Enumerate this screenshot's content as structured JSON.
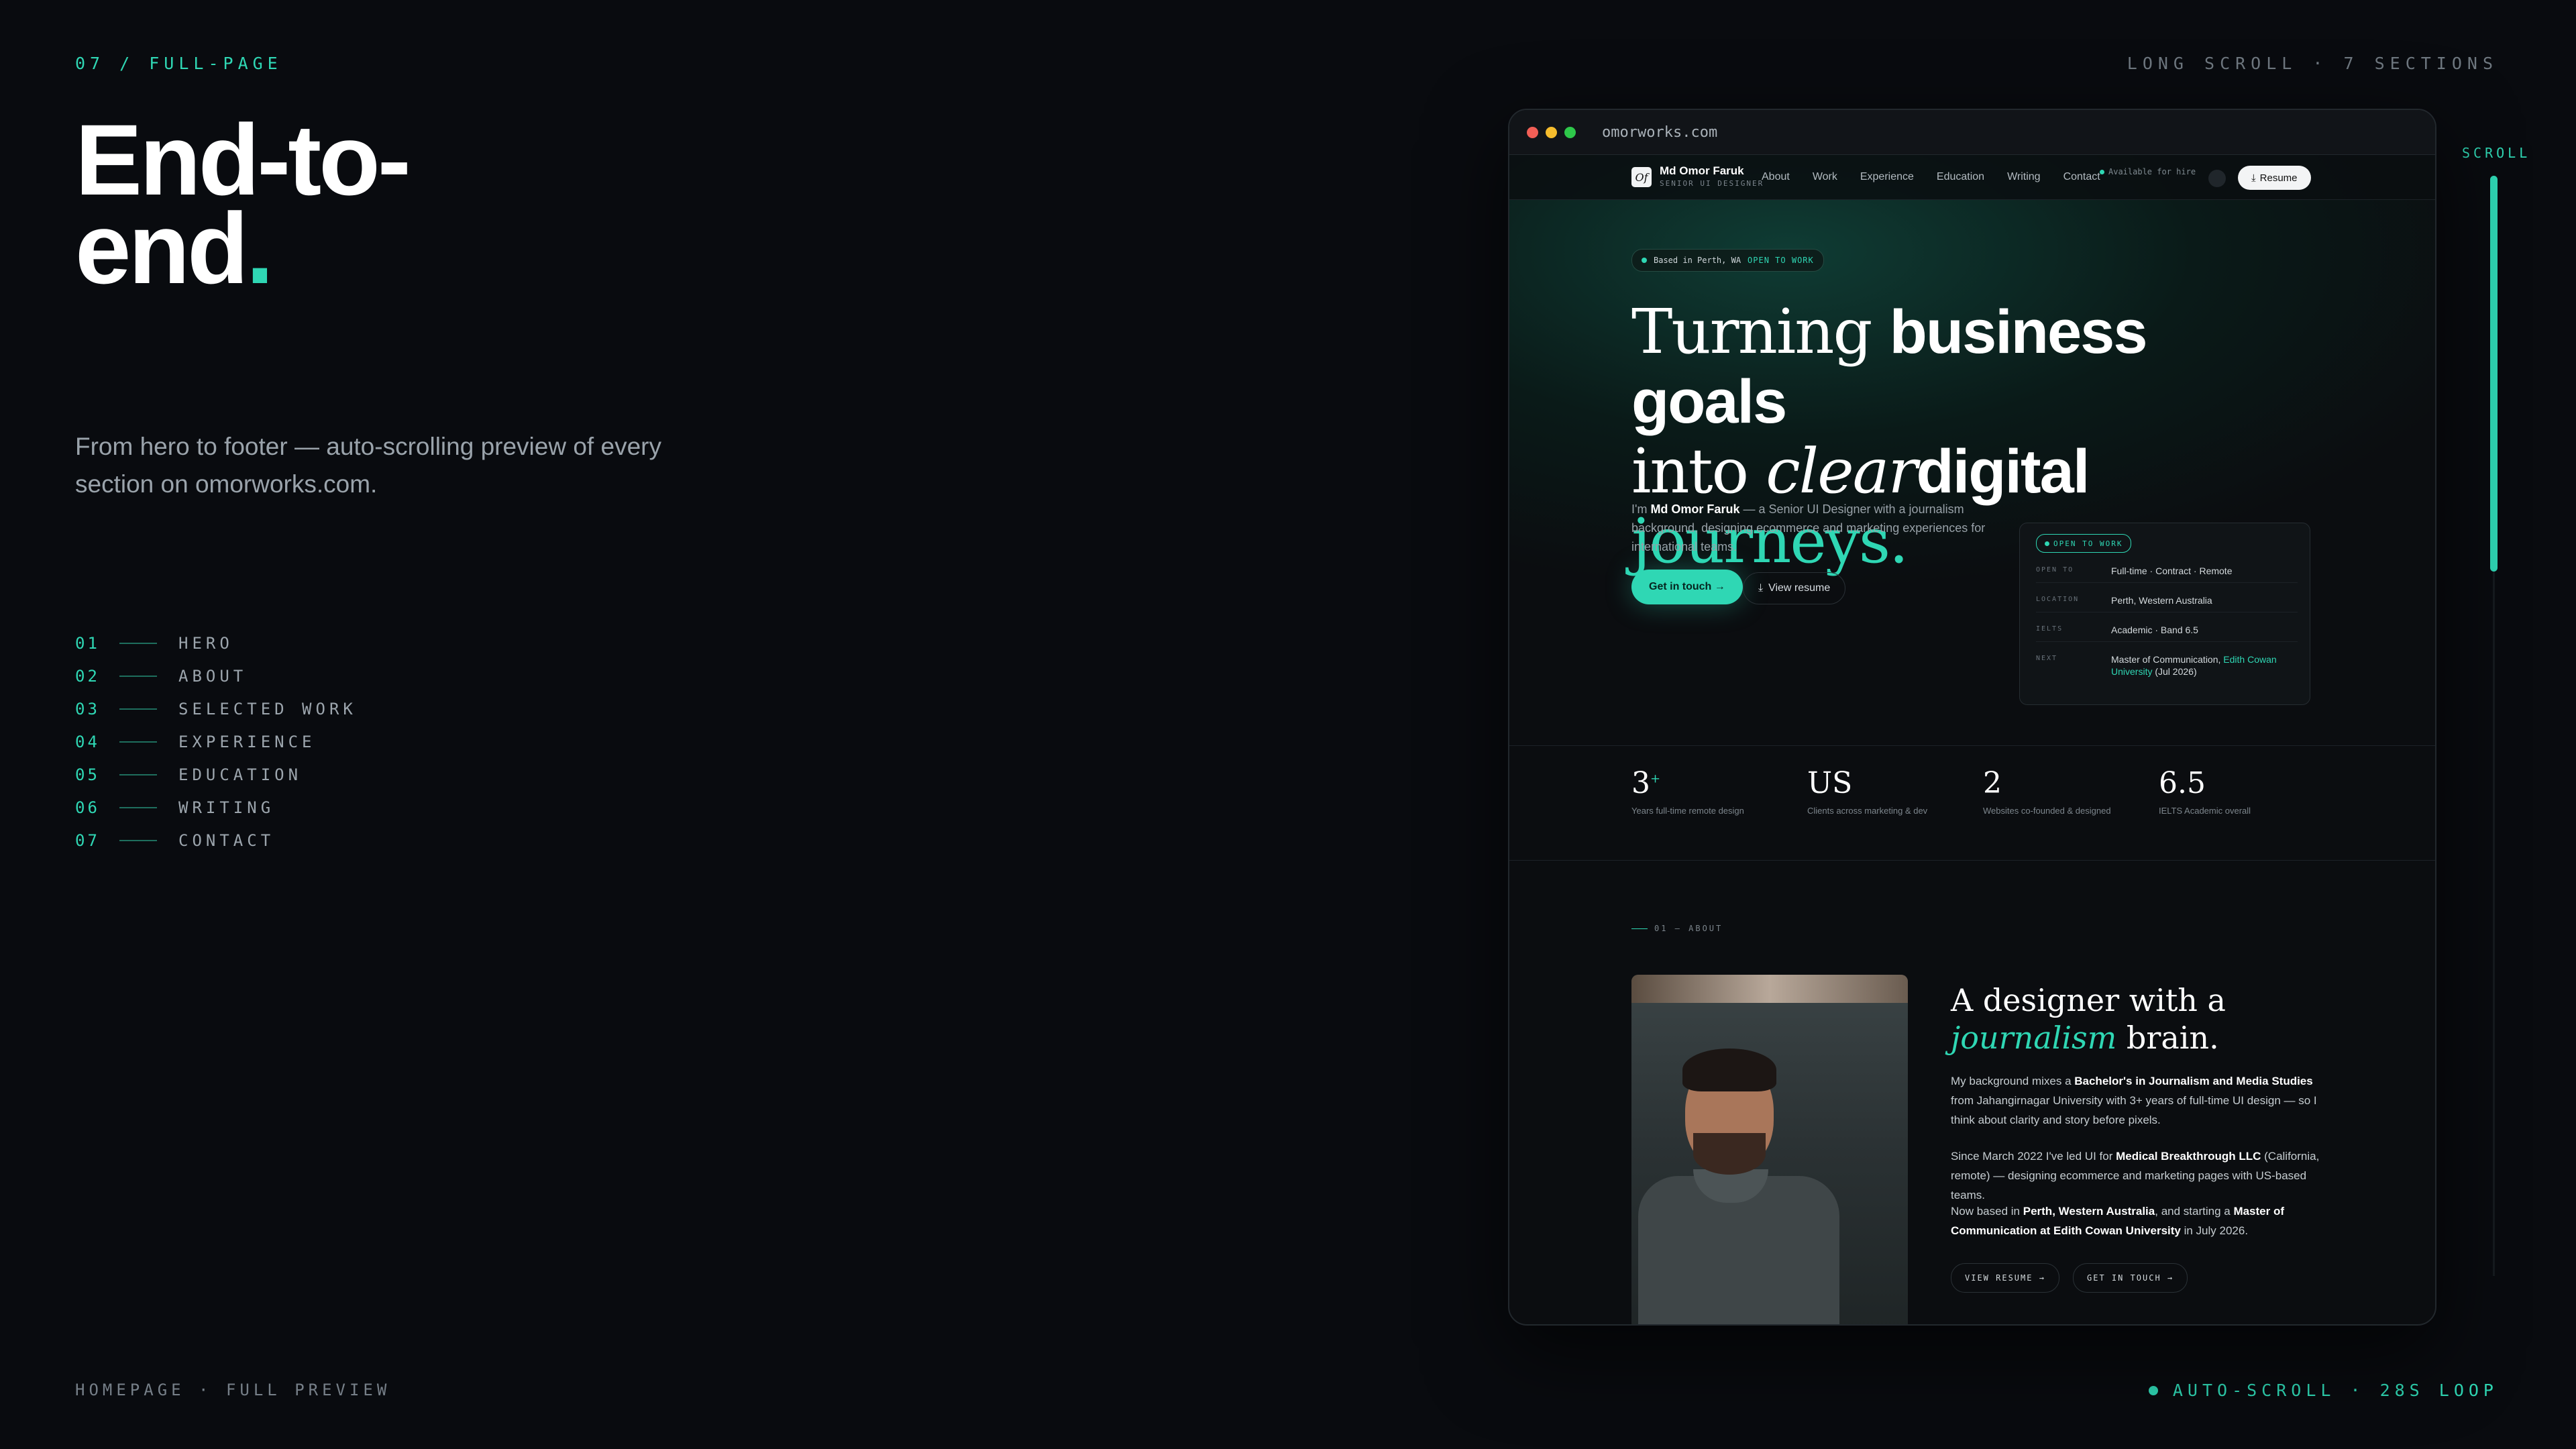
{
  "section_kicker": "07 / FULL-PAGE",
  "headline": {
    "line1": "End-to-",
    "line2": "end",
    "dot": "."
  },
  "lede": "From hero to footer — auto-scrolling preview of every section on omorworks.com.",
  "toc": [
    {
      "num": "01",
      "label": "HERO"
    },
    {
      "num": "02",
      "label": "ABOUT"
    },
    {
      "num": "03",
      "label": "SELECTED WORK"
    },
    {
      "num": "04",
      "label": "EXPERIENCE"
    },
    {
      "num": "05",
      "label": "EDUCATION"
    },
    {
      "num": "06",
      "label": "WRITING"
    },
    {
      "num": "07",
      "label": "CONTACT"
    }
  ],
  "meta_top_right": "LONG SCROLL · 7 SECTIONS",
  "scroll_label": "SCROLL",
  "scroll_progress_fraction": 0.36,
  "footer_left": "HOMEPAGE · FULL PREVIEW",
  "footer_right": "AUTO-SCROLL · 28S LOOP",
  "colors": {
    "accent": "#2fd7b4",
    "background": "#090b0f"
  },
  "browser": {
    "url": "omorworks.com",
    "site": {
      "logo": "Of",
      "brand_name": "Md Omor Faruk",
      "brand_role": "SENIOR UI DESIGNER",
      "nav": [
        "About",
        "Work",
        "Experience",
        "Education",
        "Writing",
        "Contact"
      ],
      "status": "Available for hire",
      "resume_button": "Resume",
      "location_pill": "Based in Perth, WA",
      "open_to_work": "OPEN TO WORK",
      "hero": {
        "w1": "Turning ",
        "w2": "business goals",
        "w3": "into ",
        "w4": "clear",
        "w5": "digital ",
        "w6": "journeys."
      },
      "intro_prefix": "I'm ",
      "intro_name": "Md Omor Faruk",
      "intro_rest": " — a Senior UI Designer with a journalism background, designing ecommerce and marketing experiences for international teams.",
      "cta_primary": "Get in touch →",
      "cta_secondary": "View resume",
      "card": {
        "badge": "OPEN TO WORK",
        "rows": [
          {
            "k": "OPEN TO",
            "v": "Full-time · Contract · Remote"
          },
          {
            "k": "LOCATION",
            "v": "Perth, Western Australia"
          },
          {
            "k": "IELTS",
            "v": "Academic · Band 6.5"
          },
          {
            "k": "NEXT",
            "v1": "Master of Communication, ",
            "v2": "Edith Cowan University",
            "v3": " (Jul 2026)"
          }
        ]
      },
      "stats": [
        {
          "n": "3",
          "sup": "+",
          "l": "Years full-time remote design"
        },
        {
          "n": "US",
          "sup": "",
          "l": "Clients across marketing & dev"
        },
        {
          "n": "2",
          "sup": "",
          "l": "Websites co-founded & designed"
        },
        {
          "n": "6.5",
          "sup": "",
          "l": "IELTS Academic overall"
        }
      ],
      "about": {
        "kicker": "01 — ABOUT",
        "title_a": "A designer with a ",
        "title_b": "journalism",
        "title_c": " brain.",
        "p1_a": "My background mixes a ",
        "p1_b": "Bachelor's in Journalism and Media Studies",
        "p1_c": " from Jahangirnagar University with 3+ years of full-time UI design — so I think about clarity and story before pixels.",
        "p2_a": "Since March 2022 I've led UI for ",
        "p2_b": "Medical Breakthrough LLC",
        "p2_c": " (California, remote) — designing ecommerce and marketing pages with US-based teams.",
        "p3_a": "Now based in ",
        "p3_b": "Perth, Western Australia",
        "p3_c": ", and starting a ",
        "p3_d": "Master of Communication at Edith Cowan University",
        "p3_e": " in July 2026.",
        "btn_resume": "VIEW RESUME →",
        "btn_touch": "GET IN TOUCH →"
      }
    }
  }
}
